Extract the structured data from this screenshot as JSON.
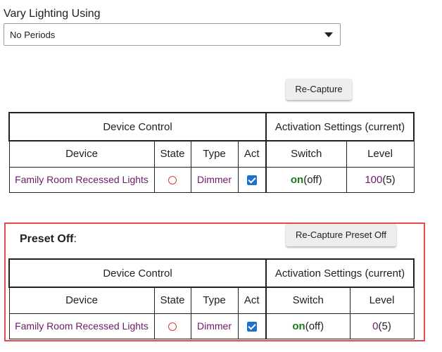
{
  "vary": {
    "label": "Vary Lighting Using",
    "selected": "No Periods"
  },
  "buttons": {
    "recapture": "Re-Capture",
    "recapture_preset": "Re-Capture Preset Off"
  },
  "table_headers": {
    "device_control": "Device Control",
    "activation": "Activation Settings (current)",
    "device": "Device",
    "state": "State",
    "type": "Type",
    "act": "Act",
    "switch": "Switch",
    "level": "Level"
  },
  "main_row": {
    "device": "Family Room Recessed Lights",
    "type": "Dimmer",
    "act_checked": true,
    "switch_on": "on",
    "switch_current": "(off)",
    "level_value": "100",
    "level_current": "(5)"
  },
  "preset": {
    "title": "Preset Off",
    "colon": ":",
    "row": {
      "device": "Family Room Recessed Lights",
      "type": "Dimmer",
      "act_checked": true,
      "switch_on": "on",
      "switch_current": "(off)",
      "level_value": "0",
      "level_current": "(5)"
    }
  },
  "colors": {
    "link": "#6a1b6a",
    "on": "#1b7a1b",
    "state_off": "#e53935",
    "checkbox": "#1f6fd0",
    "preset_border": "#e74c4c"
  }
}
